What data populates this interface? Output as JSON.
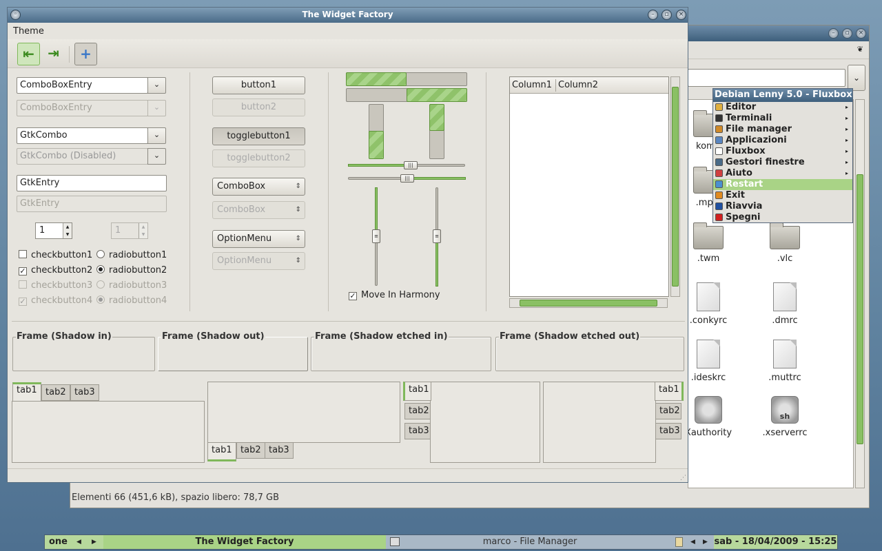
{
  "colors": {
    "accent": "#8ac064",
    "titlebar": "#4a6b88",
    "desktop": "#6a8ba6"
  },
  "file_manager": {
    "status": "Elementi 66 (451,6 kB), spazio libero: 78,7 GB",
    "files": [
      {
        "label": "komp",
        "kind": "folder"
      },
      {
        "label": ".mpla",
        "kind": "folder"
      },
      {
        "label": ".twm",
        "kind": "folder"
      },
      {
        "label": ".vlc",
        "kind": "folder"
      },
      {
        "label": ".conkyrc",
        "kind": "doc"
      },
      {
        "label": ".dmrc",
        "kind": "doc"
      },
      {
        "label": ".ideskrc",
        "kind": "doc"
      },
      {
        "label": ".muttrc",
        "kind": "doc"
      },
      {
        "label": "Xauthority",
        "kind": "gear"
      },
      {
        "label": ".xserverrc",
        "kind": "gear",
        "badge": "sh"
      }
    ]
  },
  "window": {
    "title": "The Widget Factory",
    "menu": "Theme",
    "combo1": "ComboBoxEntry",
    "combo1_dis": "ComboBoxEntry",
    "gtkcombo": "GtkCombo",
    "gtkcombo_dis": "GtkCombo (Disabled)",
    "entry": "GtkEntry",
    "entry_dis": "GtkEntry",
    "spin": "1",
    "spin_dis": "1",
    "checks": [
      {
        "check": "checkbutton1",
        "radio": "radiobutton1",
        "checked": false,
        "selected": false,
        "disabled": false
      },
      {
        "check": "checkbutton2",
        "radio": "radiobutton2",
        "checked": true,
        "selected": true,
        "disabled": false
      },
      {
        "check": "checkbutton3",
        "radio": "radiobutton3",
        "checked": false,
        "selected": false,
        "disabled": true
      },
      {
        "check": "checkbutton4",
        "radio": "radiobutton4",
        "checked": true,
        "selected": true,
        "disabled": true
      }
    ],
    "button1": "button1",
    "button2": "button2",
    "toggle1": "togglebutton1",
    "toggle2": "togglebutton2",
    "combobox": "ComboBox",
    "combobox_dis": "ComboBox",
    "optionmenu": "OptionMenu",
    "optionmenu_dis": "OptionMenu",
    "harmony": "Move In Harmony",
    "col1": "Column1",
    "col2": "Column2",
    "frames": [
      "Frame (Shadow in)",
      "Frame (Shadow out)",
      "Frame (Shadow etched in)",
      "Frame (Shadow etched out)"
    ],
    "tabs": [
      "tab1",
      "tab2",
      "tab3"
    ],
    "progress": [
      0.5,
      0.5
    ],
    "vprogress": [
      0.5,
      0.5
    ]
  },
  "fluxbox": {
    "title": "Debian Lenny 5.0 - Fluxbox",
    "items": [
      {
        "label": "Editor",
        "submenu": true,
        "color": "#e0b040"
      },
      {
        "label": "Terminali",
        "submenu": true,
        "color": "#333333"
      },
      {
        "label": "File manager",
        "submenu": true,
        "color": "#d08a2a"
      },
      {
        "label": "Applicazioni",
        "submenu": true,
        "color": "#5a86c0"
      },
      {
        "label": "Fluxbox",
        "submenu": true,
        "color": "#ffffff"
      },
      {
        "label": "Gestori finestre",
        "submenu": true,
        "color": "#4a6b88"
      },
      {
        "label": "Aiuto",
        "submenu": true,
        "color": "#d04040"
      },
      {
        "label": "Restart",
        "submenu": false,
        "color": "#4a90d0",
        "highlight": true
      },
      {
        "label": "Exit",
        "submenu": false,
        "color": "#e08a20"
      },
      {
        "label": "Riavvia",
        "submenu": false,
        "color": "#2050a0"
      },
      {
        "label": "Spegni",
        "submenu": false,
        "color": "#d02020"
      }
    ]
  },
  "taskbar": {
    "workspace": "one",
    "task1": "The Widget Factory",
    "task2": "marco - File Manager",
    "clock": "sab - 18/04/2009 - 15:25"
  }
}
